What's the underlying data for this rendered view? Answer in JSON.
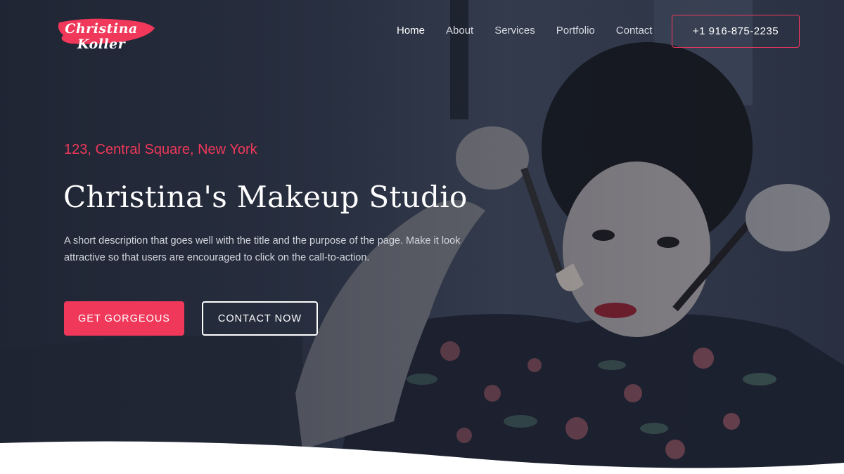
{
  "header": {
    "logo_text": "Christina Koller",
    "nav": [
      {
        "label": "Home",
        "active": true
      },
      {
        "label": "About",
        "active": false
      },
      {
        "label": "Services",
        "active": false
      },
      {
        "label": "Portfolio",
        "active": false
      },
      {
        "label": "Contact",
        "active": false
      }
    ],
    "phone_label": "+1 916-875-2235"
  },
  "hero": {
    "address": "123, Central Square, New York",
    "title": "Christina's Makeup Studio",
    "description": "A short description that goes well with the title and the purpose of the page. Make it look attractive so that users are encouraged to click on the call-to-action.",
    "primary_cta": "GET GORGEOUS",
    "secondary_cta": "CONTACT NOW"
  },
  "colors": {
    "accent": "#f0385a",
    "background_dark": "#2a3142"
  }
}
